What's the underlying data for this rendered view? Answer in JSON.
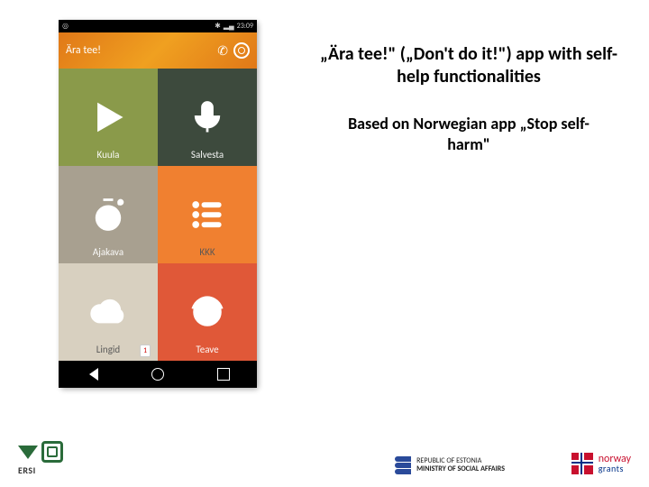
{
  "status": {
    "time": "23:09",
    "left_icon": "notif"
  },
  "app": {
    "title": "Ära tee!",
    "header_icons": [
      "phone-icon",
      "spiral-icon"
    ]
  },
  "tiles": [
    {
      "key": "kuula",
      "label": "Kuula",
      "icon": "play-icon"
    },
    {
      "key": "salvesta",
      "label": "Salvesta",
      "icon": "mic-icon"
    },
    {
      "key": "ajakava",
      "label": "Ajakava",
      "icon": "timer-icon"
    },
    {
      "key": "kkk",
      "label": "KKK",
      "icon": "list-icon"
    },
    {
      "key": "lingid",
      "label": "Lingid",
      "icon": "cloud-icon",
      "badge": "1"
    },
    {
      "key": "teave",
      "label": "Teave",
      "icon": "face-icon"
    }
  ],
  "text": {
    "heading": "„Ära tee!\" („Don't do it!\") app with self-help functionalities",
    "sub": "Based on Norwegian app „Stop self-harm\""
  },
  "footer": {
    "ersi": "ERSI",
    "ministry_l1": "REPUBLIC OF ESTONIA",
    "ministry_l2": "MINISTRY OF SOCIAL AFFAIRS",
    "norway_l1": "norway",
    "norway_l2": "grants"
  }
}
